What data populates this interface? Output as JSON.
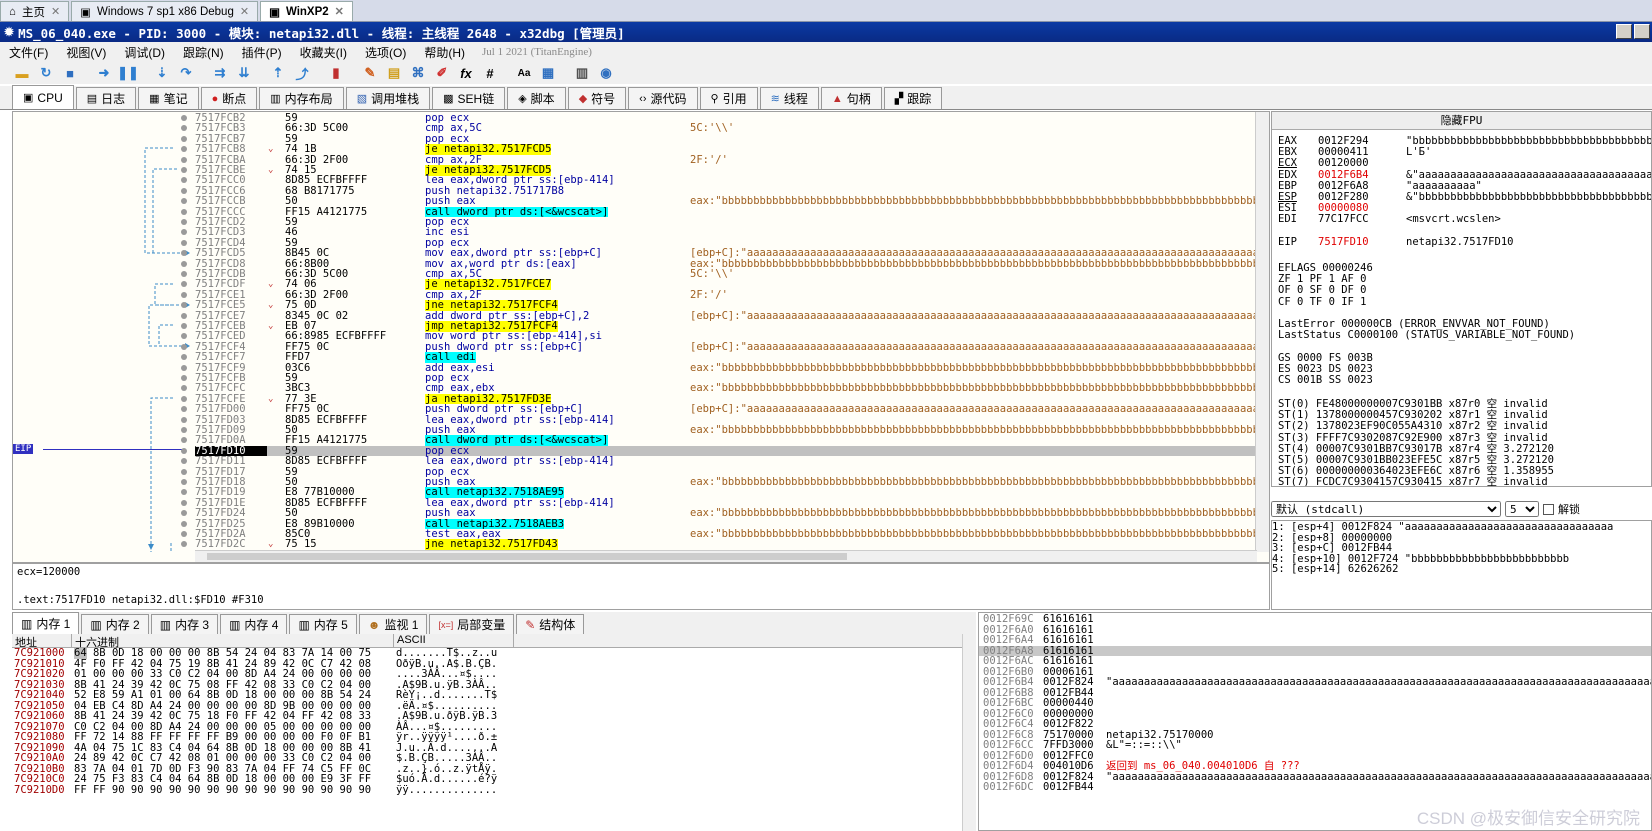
{
  "vm_tabs": [
    {
      "label": "主页"
    },
    {
      "label": "Windows 7 sp1 x86 Debug"
    },
    {
      "label": "WinXP2"
    }
  ],
  "title": "MS_06_040.exe - PID: 3000 - 模块: netapi32.dll - 线程: 主线程 2648 - x32dbg [管理员]",
  "menu": [
    "文件(F)",
    "视图(V)",
    "调试(D)",
    "跟踪(N)",
    "插件(P)",
    "收藏夹(I)",
    "选项(O)",
    "帮助(H)"
  ],
  "menu_info": "Jul 1 2021 (TitanEngine)",
  "toolbar_icons": [
    "open-icon",
    "restart-icon",
    "stop-icon",
    "run-icon",
    "pause-icon",
    "step-into-icon",
    "step-over-icon",
    "trace-into-icon",
    "trace-over-icon",
    "execute-till-return-icon",
    "run-to-user-code-icon",
    "scylla-icon",
    "patch-icon",
    "comment-icon",
    "label-icon",
    "bookmark-icon",
    "function-icon",
    "hash-icon",
    "font-icon",
    "calculator-icon",
    "favourite-icon",
    "help-icon"
  ],
  "view_tabs": [
    {
      "label": "CPU",
      "icon": "cpu-icon"
    },
    {
      "label": "日志",
      "icon": "log-icon"
    },
    {
      "label": "笔记",
      "icon": "notes-icon"
    },
    {
      "label": "断点",
      "icon": "breakpoint-icon"
    },
    {
      "label": "内存布局",
      "icon": "memory-map-icon"
    },
    {
      "label": "调用堆栈",
      "icon": "callstack-icon"
    },
    {
      "label": "SEH链",
      "icon": "seh-icon"
    },
    {
      "label": "脚本",
      "icon": "script-icon"
    },
    {
      "label": "符号",
      "icon": "symbols-icon"
    },
    {
      "label": "源代码",
      "icon": "source-icon"
    },
    {
      "label": "引用",
      "icon": "references-icon"
    },
    {
      "label": "线程",
      "icon": "threads-icon"
    },
    {
      "label": "句柄",
      "icon": "handles-icon"
    },
    {
      "label": "跟踪",
      "icon": "trace-icon"
    }
  ],
  "eip_label": "EIP",
  "disasm": [
    {
      "addr": "7517FCB2",
      "bytes": "59",
      "ins": "pop ecx",
      "cmt": ""
    },
    {
      "addr": "7517FCB3",
      "bytes": "66:3D 5C00",
      "ins": "cmp ax,5C",
      "cmt": "5C:'\\\\'"
    },
    {
      "addr": "7517FCB7",
      "bytes": "59",
      "ins": "pop ecx",
      "cmt": ""
    },
    {
      "addr": "7517FCB8",
      "bytes": "74 1B",
      "ins": "je netapi32.7517FCD5",
      "cmt": "",
      "hl": "jmp",
      "chev": true
    },
    {
      "addr": "7517FCBA",
      "bytes": "66:3D 2F00",
      "ins": "cmp ax,2F",
      "cmt": "2F:'/'"
    },
    {
      "addr": "7517FCBE",
      "bytes": "74 15",
      "ins": "je netapi32.7517FCD5",
      "cmt": "",
      "hl": "jmp",
      "chev": true
    },
    {
      "addr": "7517FCC0",
      "bytes": "8D85 ECFBFFFF",
      "ins": "lea eax,dword ptr ss:[ebp-414]",
      "cmt": "",
      "hl": "mem"
    },
    {
      "addr": "7517FCC6",
      "bytes": "68 B8171775",
      "ins": "push netapi32.751717B8",
      "cmt": ""
    },
    {
      "addr": "7517FCCB",
      "bytes": "50",
      "ins": "push eax",
      "cmt": "eax:\"bbbbbbbbbbbbbbbbbbbbbbbbbbbbbbbbbbbbbbbbbbbbbbbbbbbbbbbbbbbbbbbbbbbbbbbbbbbbbbbbbbbbbbbbbbbbbbbbbbbbb"
    },
    {
      "addr": "7517FCCC",
      "bytes": "FF15 A4121775",
      "ins": "call dword ptr ds:[<&wcscat>]",
      "cmt": "",
      "hl": "call"
    },
    {
      "addr": "7517FCD2",
      "bytes": "59",
      "ins": "pop ecx",
      "cmt": ""
    },
    {
      "addr": "7517FCD3",
      "bytes": "46",
      "ins": "inc esi",
      "cmt": ""
    },
    {
      "addr": "7517FCD4",
      "bytes": "59",
      "ins": "pop ecx",
      "cmt": ""
    },
    {
      "addr": "7517FCD5",
      "bytes": "8B45 0C",
      "ins": "mov eax,dword ptr ss:[ebp+C]",
      "cmt": "[ebp+C]:\"aaaaaaaaaaaaaaaaaaaaaaaaaaaaaaaaaaaaaaaaaaaaaaaaaaaaaaaaaaaaaaaaaaaaaaaaaaaaaaaaaaaaaaaaaaaaaaa",
      "hl": "mem"
    },
    {
      "addr": "7517FCD8",
      "bytes": "66:8B00",
      "ins": "mov ax,word ptr ds:[eax]",
      "cmt": "eax:\"bbbbbbbbbbbbbbbbbbbbbbbbbbbbbbbbbbbbbbbbbbbbbbbbbbbbbbbbbbbbbbbbbbbbbbbbbbbbbbbbbbbbbbbbbbbbbbbbbbbbb"
    },
    {
      "addr": "7517FCDB",
      "bytes": "66:3D 5C00",
      "ins": "cmp ax,5C",
      "cmt": "5C:'\\\\'"
    },
    {
      "addr": "7517FCDF",
      "bytes": "74 06",
      "ins": "je netapi32.7517FCE7",
      "cmt": "",
      "hl": "jmp",
      "chev": true
    },
    {
      "addr": "7517FCE1",
      "bytes": "66:3D 2F00",
      "ins": "cmp ax,2F",
      "cmt": "2F:'/'"
    },
    {
      "addr": "7517FCE5",
      "bytes": "75 0D",
      "ins": "jne netapi32.7517FCF4",
      "cmt": "",
      "hl": "jmp",
      "chev": true
    },
    {
      "addr": "7517FCE7",
      "bytes": "8345 0C 02",
      "ins": "add dword ptr ss:[ebp+C],2",
      "cmt": "[ebp+C]:\"aaaaaaaaaaaaaaaaaaaaaaaaaaaaaaaaaaaaaaaaaaaaaaaaaaaaaaaaaaaaaaaaaaaaaaaaaaaaaaaaaaaaaaaaaaaaaaa",
      "hl": "mem"
    },
    {
      "addr": "7517FCEB",
      "bytes": "EB 07",
      "ins": "jmp netapi32.7517FCF4",
      "cmt": "",
      "hl": "jmp",
      "chev": true
    },
    {
      "addr": "7517FCED",
      "bytes": "66:8985 ECFBFFFF",
      "ins": "mov word ptr ss:[ebp-414],si",
      "cmt": "",
      "hl": "mem"
    },
    {
      "addr": "7517FCF4",
      "bytes": "FF75 0C",
      "ins": "push dword ptr ss:[ebp+C]",
      "cmt": "[ebp+C]:\"aaaaaaaaaaaaaaaaaaaaaaaaaaaaaaaaaaaaaaaaaaaaaaaaaaaaaaaaaaaaaaaaaaaaaaaaaaaaaaaaaaaaaaaaaaaaaaa",
      "hl": "mem"
    },
    {
      "addr": "7517FCF7",
      "bytes": "FFD7",
      "ins": "call edi",
      "cmt": "",
      "hl": "call"
    },
    {
      "addr": "7517FCF9",
      "bytes": "03C6",
      "ins": "add eax,esi",
      "cmt": "eax:\"bbbbbbbbbbbbbbbbbbbbbbbbbbbbbbbbbbbbbbbbbbbbbbbbbbbbbbbbbbbbbbbbbbbbbbbbbbbbbbbbbbbbbbbbbbbbbbbbbbbbb"
    },
    {
      "addr": "7517FCFB",
      "bytes": "59",
      "ins": "pop ecx",
      "cmt": ""
    },
    {
      "addr": "7517FCFC",
      "bytes": "3BC3",
      "ins": "cmp eax,ebx",
      "cmt": "eax:\"bbbbbbbbbbbbbbbbbbbbbbbbbbbbbbbbbbbbbbbbbbbbbbbbbbbbbbbbbbbbbbbbbbbbbbbbbbbbbbbbbbbbbbbbbbbbbbbbbbbbb"
    },
    {
      "addr": "7517FCFE",
      "bytes": "77 3E",
      "ins": "ja netapi32.7517FD3E",
      "cmt": "",
      "hl": "jmp",
      "chev": true
    },
    {
      "addr": "7517FD00",
      "bytes": "FF75 0C",
      "ins": "push dword ptr ss:[ebp+C]",
      "cmt": "[ebp+C]:\"aaaaaaaaaaaaaaaaaaaaaaaaaaaaaaaaaaaaaaaaaaaaaaaaaaaaaaaaaaaaaaaaaaaaaaaaaaaaaaaaaaaaaaaaaaaaaaa",
      "hl": "mem"
    },
    {
      "addr": "7517FD03",
      "bytes": "8D85 ECFBFFFF",
      "ins": "lea eax,dword ptr ss:[ebp-414]",
      "cmt": "",
      "hl": "mem"
    },
    {
      "addr": "7517FD09",
      "bytes": "50",
      "ins": "push eax",
      "cmt": "eax:\"bbbbbbbbbbbbbbbbbbbbbbbbbbbbbbbbbbbbbbbbbbbbbbbbbbbbbbbbbbbbbbbbbbbbbbbbbbbbbbbbbbbbbbbbbbbbbbbbbbbbb"
    },
    {
      "addr": "7517FD0A",
      "bytes": "FF15 A4121775",
      "ins": "call dword ptr ds:[<&wcscat>]",
      "cmt": "",
      "hl": "call"
    },
    {
      "addr": "7517FD10",
      "bytes": "59",
      "ins": "pop ecx",
      "cmt": "",
      "cur": true
    },
    {
      "addr": "7517FD11",
      "bytes": "8D85 ECFBFFFF",
      "ins": "lea eax,dword ptr ss:[ebp-414]",
      "cmt": "",
      "hl": "mem"
    },
    {
      "addr": "7517FD17",
      "bytes": "59",
      "ins": "pop ecx",
      "cmt": ""
    },
    {
      "addr": "7517FD18",
      "bytes": "50",
      "ins": "push eax",
      "cmt": "eax:\"bbbbbbbbbbbbbbbbbbbbbbbbbbbbbbbbbbbbbbbbbbbbbbbbbbbbbbbbbbbbbbbbbbbbbbbbbbbbbbbbbbbbbbbbbbbbbbbbbbbbb"
    },
    {
      "addr": "7517FD19",
      "bytes": "E8 77B10000",
      "ins": "call netapi32.7518AE95",
      "cmt": "",
      "hl": "call"
    },
    {
      "addr": "7517FD1E",
      "bytes": "8D85 ECFBFFFF",
      "ins": "lea eax,dword ptr ss:[ebp-414]",
      "cmt": "",
      "hl": "mem"
    },
    {
      "addr": "7517FD24",
      "bytes": "50",
      "ins": "push eax",
      "cmt": "eax:\"bbbbbbbbbbbbbbbbbbbbbbbbbbbbbbbbbbbbbbbbbbbbbbbbbbbbbbbbbbbbbbbbbbbbbbbbbbbbbbbbbbbbbbbbbbbbbbbbbbbbb"
    },
    {
      "addr": "7517FD25",
      "bytes": "E8 89B10000",
      "ins": "call netapi32.7518AEB3",
      "cmt": "",
      "hl": "call"
    },
    {
      "addr": "7517FD2A",
      "bytes": "85C0",
      "ins": "test eax,eax",
      "cmt": "eax:\"bbbbbbbbbbbbbbbbbbbbbbbbbbbbbbbbbbbbbbbbbbbbbbbbbbbbbbbbbbbbbbbbbbbbbbbbbbbbbbbbbbbbbbbbbbbbbbbbbbbbb"
    },
    {
      "addr": "7517FD2C",
      "bytes": "75 15",
      "ins": "jne netapi32.7517FD43",
      "cmt": "",
      "hl": "jmp",
      "chev": true
    }
  ],
  "info_lines": [
    "ecx=120000",
    "",
    ".text:7517FD10 netapi32.dll:$FD10 #F310"
  ],
  "reg_header": "隐藏FPU",
  "registers": [
    {
      "name": "EAX",
      "val": "0012F294",
      "info": "\"bbbbbbbbbbbbbbbbbbbbbbbbbbbbbbbbbbbbbbbbbbbb"
    },
    {
      "name": "EBX",
      "val": "00000411",
      "info": "L'Б'"
    },
    {
      "name": "ECX",
      "val": "00120000",
      "info": ""
    },
    {
      "name": "EDX",
      "val": "0012F6B4",
      "info": "&\"aaaaaaaaaaaaaaaaaaaaaaaaaaaaaaaaaaaaaaaaaa",
      "red": true
    },
    {
      "name": "EBP",
      "val": "0012F6A8",
      "info": "\"aaaaaaaaaa\""
    },
    {
      "name": "ESP",
      "val": "0012F280",
      "info": "&\"bbbbbbbbbbbbbbbbbbbbbbbbbbbbbbbbbbbbbbbbbbb"
    },
    {
      "name": "ESI",
      "val": "00000080",
      "info": "",
      "red": true
    },
    {
      "name": "EDI",
      "val": "77C17FCC",
      "info": "<msvcrt.wcslen>"
    },
    {
      "name": "",
      "val": "",
      "info": ""
    },
    {
      "name": "EIP",
      "val": "7517FD10",
      "info": "netapi32.7517FD10",
      "red": true
    }
  ],
  "flags": [
    "EFLAGS   00000246",
    "ZF 1  PF 1  AF 0",
    "OF 0  SF 0  DF 0",
    "CF 0  TF 0  IF 1"
  ],
  "errors": [
    "LastError  000000CB (ERROR_ENVVAR_NOT_FOUND)",
    "LastStatus C0000100 (STATUS_VARIABLE_NOT_FOUND)"
  ],
  "segs": [
    "GS 0000  FS 003B",
    "ES 0023  DS 0023",
    "CS 001B  SS 0023"
  ],
  "fpu": [
    "ST(0) FE48000000007C9301BB x87r0 空 invalid",
    "ST(1) 1378000000457C930202 x87r1 空 invalid",
    "ST(2) 1378023EF90C055A4310 x87r2 空 invalid",
    "ST(3) FFFF7C9302087C92E900 x87r3 空 invalid",
    "ST(4) 00007C9301BB7C93017B x87r4 空 3.272120",
    "ST(5) 00007C9301BB023EFE5C x87r5 空 3.272120",
    "ST(6) 000000000364023EFE6C x87r6 空 1.358955",
    "ST(7) FCDC7C9304157C930415 x87r7 空 invalid"
  ],
  "callconv": {
    "selected": "默认 (stdcall)",
    "count": "5",
    "unlock_label": "解锁"
  },
  "stack_args": [
    "1: [esp+4] 0012F824 \"aaaaaaaaaaaaaaaaaaaaaaaaaaaaaaaaa",
    "2: [esp+8] 00000000",
    "3: [esp+C] 0012FB44",
    "4: [esp+10] 0012F724 \"bbbbbbbbbbbbbbbbbbbbbbbbb",
    "5: [esp+14] 62626262"
  ],
  "dump_tabs": [
    {
      "label": "内存 1",
      "icon": "memory-icon"
    },
    {
      "label": "内存 2",
      "icon": "memory-icon"
    },
    {
      "label": "内存 3",
      "icon": "memory-icon"
    },
    {
      "label": "内存 4",
      "icon": "memory-icon"
    },
    {
      "label": "内存 5",
      "icon": "memory-icon"
    },
    {
      "label": "监视 1",
      "icon": "watch-icon"
    },
    {
      "label": "局部变量",
      "icon": "locals-icon"
    },
    {
      "label": "结构体",
      "icon": "struct-icon"
    }
  ],
  "dump_headers": {
    "addr": "地址",
    "hex": "十六进制",
    "ascii": "ASCII"
  },
  "dump": [
    {
      "addr": "7C921000",
      "hex": "64 8B 0D 18 00 00 00 8B 54 24 04 83 7A 14 00 75",
      "ascii": "d.......T$..z..u"
    },
    {
      "addr": "7C921010",
      "hex": "4F F0 FF 42 04 75 19 8B 41 24 89 42 0C C7 42 08",
      "ascii": "OðÿB.u..A$.B.ÇB."
    },
    {
      "addr": "7C921020",
      "hex": "01 00 00 00 33 C0 C2 04 00 8D A4 24 00 00 00 00",
      "ascii": "....3ÀÂ...¤$...."
    },
    {
      "addr": "7C921030",
      "hex": "8B 41 24 39 42 0C 75 08 FF 42 08 33 C0 C2 04 00",
      "ascii": ".A$9B.u.ÿB.3ÀÂ.."
    },
    {
      "addr": "7C921040",
      "hex": "52 E8 59 A1 01 00 64 8B 0D 18 00 00 00 8B 54 24",
      "ascii": "RèY¡..d.......T$"
    },
    {
      "addr": "7C921050",
      "hex": "04 EB C4 8D A4 24 00 00 00 00 8D 9B 00 00 00 00",
      "ascii": ".ëÄ.¤$.........."
    },
    {
      "addr": "7C921060",
      "hex": "8B 41 24 39 42 0C 75 18 F0 FF 42 04 FF 42 08 33",
      "ascii": ".A$9B.u.ðÿB.ÿB.3"
    },
    {
      "addr": "7C921070",
      "hex": "C0 C2 04 00 8D A4 24 00 00 00 05 00 00 00 00 00",
      "ascii": "ÀÂ...¤$........."
    },
    {
      "addr": "7C921080",
      "hex": "FF 72 14 88 FF FF FF FF B9 00 00 00 00 F0 0F B1",
      "ascii": "ÿr..ÿÿÿÿ¹....ð.±"
    },
    {
      "addr": "7C921090",
      "hex": "4A 04 75 1C 83 C4 04 64 8B 0D 18 00 00 00 8B 41",
      "ascii": "J.u..Ä.d.......A"
    },
    {
      "addr": "7C9210A0",
      "hex": "24 89 42 0C C7 42 08 01 00 00 00 33 C0 C2 04 00",
      "ascii": "$.B.ÇB.....3ÀÂ.."
    },
    {
      "addr": "7C9210B0",
      "hex": "83 7A 04 01 7D 0D F3 90 83 7A 04 FF 74 C5 FF 0C",
      "ascii": ".z..}.ó..z.ÿtÅÿ."
    },
    {
      "addr": "7C9210C0",
      "hex": "24 75 F3 83 C4 04 64 8B 0D 18 00 00 00 E9 3F FF",
      "ascii": "$uó.Ä.d......é?ÿ"
    },
    {
      "addr": "7C9210D0",
      "hex": "FF FF 90 90 90 90 90 90 90 90 90 90 90 90 90 90",
      "ascii": "ÿÿ.............."
    }
  ],
  "stack": [
    {
      "addr": "0012F69C",
      "val": "61616161",
      "cmt": ""
    },
    {
      "addr": "0012F6A0",
      "val": "61616161",
      "cmt": ""
    },
    {
      "addr": "0012F6A4",
      "val": "61616161",
      "cmt": ""
    },
    {
      "addr": "0012F6A8",
      "val": "61616161",
      "cmt": "",
      "cur": true
    },
    {
      "addr": "0012F6AC",
      "val": "61616161",
      "cmt": ""
    },
    {
      "addr": "0012F6B0",
      "val": "00006161",
      "cmt": ""
    },
    {
      "addr": "0012F6B4",
      "val": "0012F824",
      "cmt": "\"aaaaaaaaaaaaaaaaaaaaaaaaaaaaaaaaaaaaaaaaaaaaaaaaaaaaaaaaaaaaaaaaaaaaaaaaaaaaaaaaaaaaaaaaaa"
    },
    {
      "addr": "0012F6B8",
      "val": "0012FB44",
      "cmt": ""
    },
    {
      "addr": "0012F6BC",
      "val": "00000440",
      "cmt": ""
    },
    {
      "addr": "0012F6C0",
      "val": "00000000",
      "cmt": ""
    },
    {
      "addr": "0012F6C4",
      "val": "0012F822",
      "cmt": ""
    },
    {
      "addr": "0012F6C8",
      "val": "75170000",
      "cmt": "netapi32.75170000"
    },
    {
      "addr": "0012F6CC",
      "val": "7FFD3000",
      "cmt": "&L\"=::=::\\\\\""
    },
    {
      "addr": "0012F6D0",
      "val": "0012FFC0",
      "cmt": ""
    },
    {
      "addr": "0012F6D4",
      "val": "004010D6",
      "cmt": "返回到 ms_06_040.004010D6 自 ???",
      "ret": true
    },
    {
      "addr": "0012F6D8",
      "val": "0012F824",
      "cmt": "\"aaaaaaaaaaaaaaaaaaaaaaaaaaaaaaaaaaaaaaaaaaaaaaaaaaaaaaaaaaaaaaaaaaaaaaaaaaaaaaaaaaaaaaaaa"
    },
    {
      "addr": "0012F6DC",
      "val": "0012FB44",
      "cmt": ""
    }
  ],
  "watermark": "CSDN @极安御信安全研究院"
}
